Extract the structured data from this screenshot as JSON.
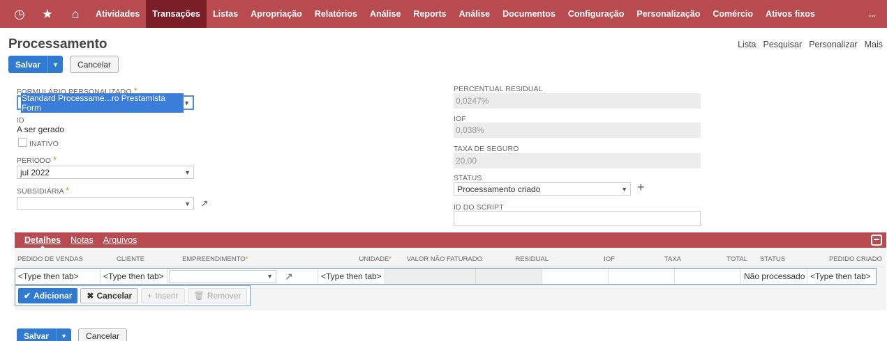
{
  "nav": {
    "icons": [
      "clock-icon",
      "star-icon",
      "home-icon"
    ],
    "items": [
      {
        "label": "Atividades",
        "active": false
      },
      {
        "label": "Transações",
        "active": true
      },
      {
        "label": "Listas",
        "active": false
      },
      {
        "label": "Apropriação",
        "active": false
      },
      {
        "label": "Relatórios",
        "active": false
      },
      {
        "label": "Análise",
        "active": false
      },
      {
        "label": "Reports",
        "active": false
      },
      {
        "label": "Análise",
        "active": false
      },
      {
        "label": "Documentos",
        "active": false
      },
      {
        "label": "Configuração",
        "active": false
      },
      {
        "label": "Personalização",
        "active": false
      },
      {
        "label": "Comércio",
        "active": false
      },
      {
        "label": "Ativos fixos",
        "active": false
      }
    ],
    "more": "..."
  },
  "page": {
    "title": "Processamento",
    "links": [
      "Lista",
      "Pesquisar",
      "Personalizar",
      "Mais"
    ]
  },
  "buttons": {
    "save": "Salvar",
    "cancel": "Cancelar"
  },
  "form": {
    "custom_form_label": "FORMULÁRIO PERSONALIZADO",
    "custom_form_value": "Standard Processame...ro Prestamista Form",
    "id_label": "ID",
    "id_value": "A ser gerado",
    "inactive_label": "INATIVO",
    "period_label": "PERÍODO",
    "period_value": "jul 2022",
    "subsidiary_label": "SUBSIDIÁRIA",
    "subsidiary_value": "",
    "residual_label": "PERCENTUAL RESIDUAL",
    "residual_value": "0,0247%",
    "iof_label": "IOF",
    "iof_value": "0,038%",
    "insurance_label": "TAXA DE SEGURO",
    "insurance_value": "20,00",
    "status_label": "STATUS",
    "status_value": "Processamento criado",
    "script_label": "ID DO SCRIPT",
    "required_mark": "*"
  },
  "subtabs": [
    "Detalhes",
    "Notas",
    "Arquivos"
  ],
  "grid": {
    "columns": [
      "PEDIDO DE VENDAS",
      "CLIENTE",
      "EMPREENDIMENTO",
      "UNIDADE",
      "VALOR NÃO FATURADO",
      "RESIDUAL",
      "IOF",
      "TAXA",
      "TOTAL",
      "STATUS",
      "PEDIDO CRIADO"
    ],
    "row": {
      "pedido": "<Type then tab>",
      "cliente": "<Type then tab>",
      "empreendimento": "",
      "unidade": "<Type then tab>",
      "status": "Não processado",
      "pedido_criado": "<Type then tab>"
    },
    "buttons": {
      "add": "Adicionar",
      "cancel": "Cancelar",
      "insert": "Inserir",
      "remove": "Remover"
    }
  },
  "colors": {
    "nav_bg": "#b94a4f",
    "nav_active": "#7b1e27",
    "primary": "#2f7bd1"
  }
}
